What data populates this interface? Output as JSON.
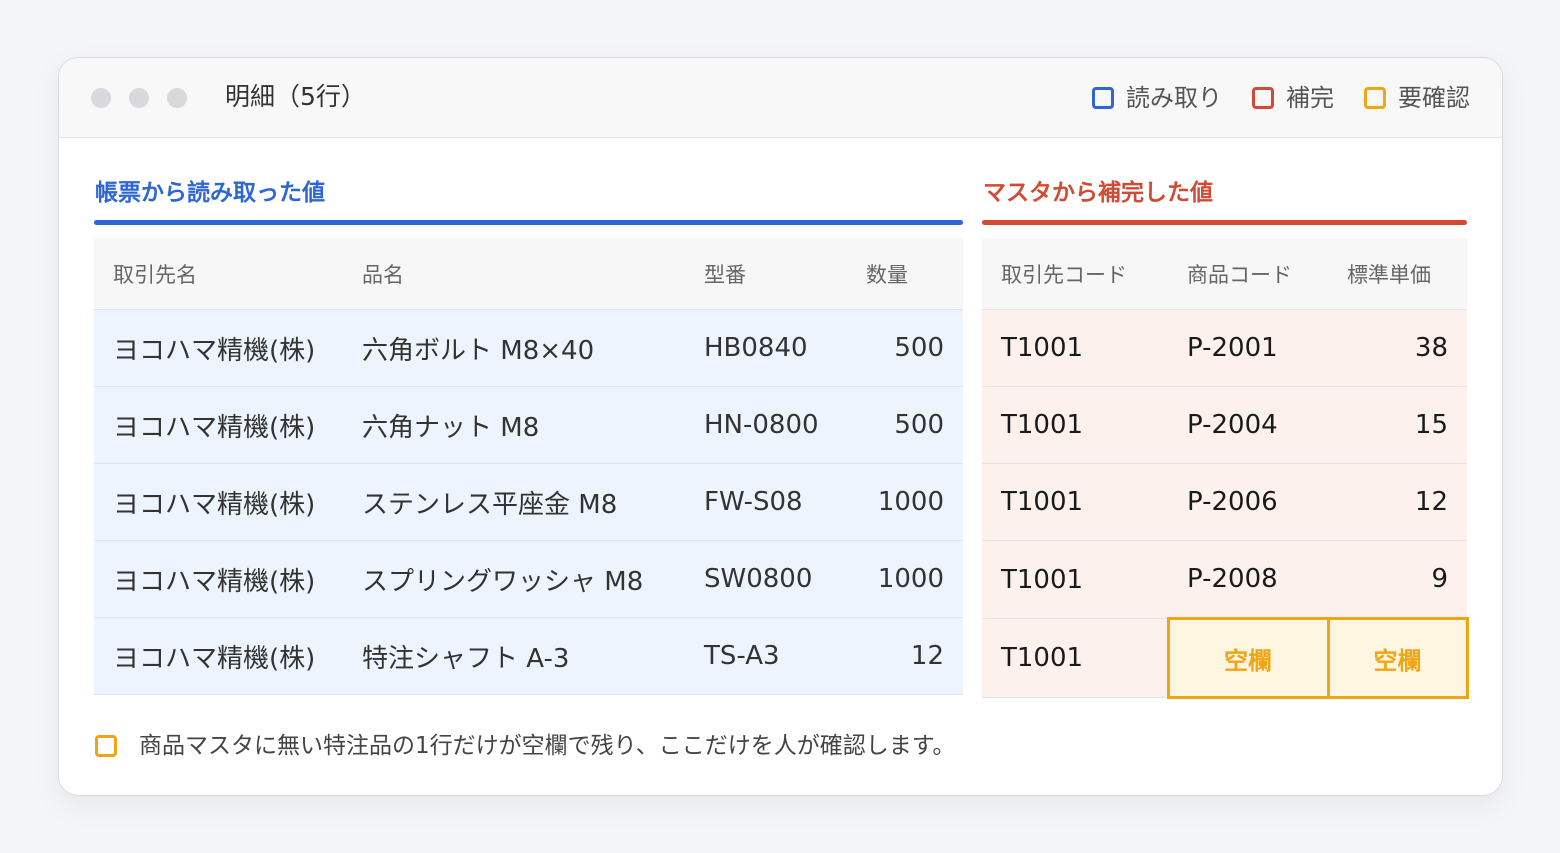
{
  "window": {
    "title": "明細（5行）",
    "legend": [
      {
        "label": "読み取り",
        "color": "#2e66d6"
      },
      {
        "label": "補完",
        "color": "#d24a33"
      },
      {
        "label": "要確認",
        "color": "#f0a514"
      }
    ]
  },
  "left": {
    "heading": "帳票から読み取った値",
    "columns": [
      "取引先名",
      "品名",
      "型番",
      "数量"
    ],
    "rows": [
      [
        "ヨコハマ精機(株)",
        "六角ボルト M8×40",
        "HB0840",
        "500"
      ],
      [
        "ヨコハマ精機(株)",
        "六角ナット M8",
        "HN-0800",
        "500"
      ],
      [
        "ヨコハマ精機(株)",
        "ステンレス平座金 M8",
        "FW-S08",
        "1000"
      ],
      [
        "ヨコハマ精機(株)",
        "スプリングワッシャ M8",
        "SW0800",
        "1000"
      ],
      [
        "ヨコハマ精機(株)",
        "特注シャフト A-3",
        "TS-A3",
        "12"
      ]
    ]
  },
  "right": {
    "heading": "マスタから補完した値",
    "columns": [
      "取引先コード",
      "商品コード",
      "標準単価"
    ],
    "rows": [
      [
        "T1001",
        "P-2001",
        "38"
      ],
      [
        "T1001",
        "P-2004",
        "15"
      ],
      [
        "T1001",
        "P-2006",
        "12"
      ],
      [
        "T1001",
        "P-2008",
        "9"
      ],
      [
        "T1001",
        "空欄",
        "空欄"
      ]
    ]
  },
  "footer": {
    "note": "商品マスタに無い特注品の1行だけが空欄で残り、ここだけを人が確認します。"
  },
  "colors": {
    "read": "#2e66d6",
    "complement": "#d24a33",
    "review": "#f0a514"
  }
}
